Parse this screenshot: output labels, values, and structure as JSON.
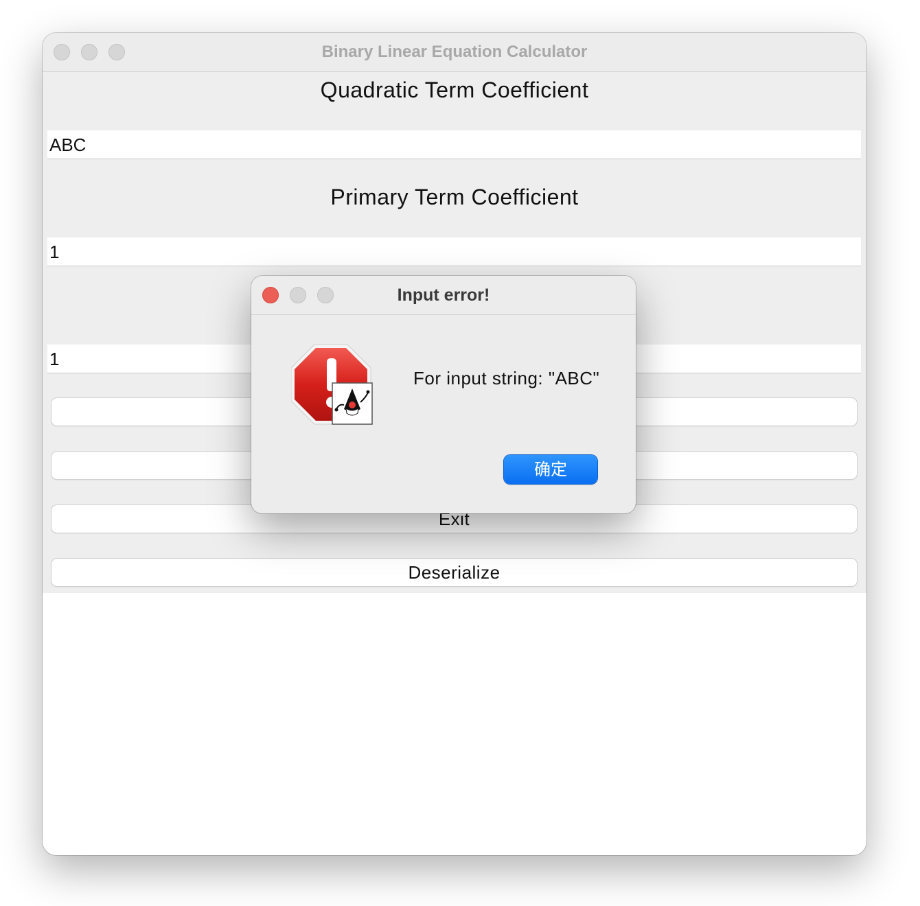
{
  "window": {
    "title": "Binary Linear Equation Calculator"
  },
  "form": {
    "quadratic_label": "Quadratic Term Coefficient",
    "quadratic_value": "ABC",
    "primary_label": "Primary Term Coefficient",
    "primary_value": "1",
    "constant_value": "1"
  },
  "buttons": {
    "exit_label": "Exit",
    "deserialize_label": "Deserialize"
  },
  "dialog": {
    "title": "Input error!",
    "message": "For input string: \"ABC\"",
    "ok_label": "确定",
    "icon": "error-stop-sign-icon with java-duke badge",
    "ok_color": "#1a82fb",
    "close_button_color": "#ec5f57"
  }
}
